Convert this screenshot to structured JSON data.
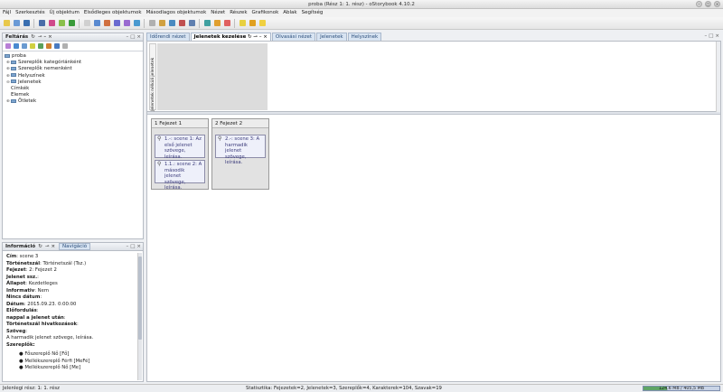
{
  "window": {
    "title": "proba (Rész 1: 1. rész) - oStorybook 4.10.2"
  },
  "menu": [
    "Fájl",
    "Szerkesztés",
    "Új objektum",
    "Elsődleges objektumok",
    "Másodlagos objektumok",
    "Nézet",
    "Részek",
    "Grafikonok",
    "Ablak",
    "Segítség"
  ],
  "toolbar": {
    "colors": [
      "#e8c84a",
      "#6a9ad6",
      "#3a6fb0",
      "#4a6da8",
      "#d04a8a",
      "#8ac04a",
      "#3a9b3a",
      "#d0d0d0",
      "#5a8ad0",
      "#d07040",
      "#6a6ad0",
      "#9a6ad0",
      "#4a9ad0",
      "#b0b0b0",
      "#d0a040",
      "#4a8ac0",
      "#c05050",
      "#6080b0",
      "#40a0a0",
      "#e0a030",
      "#e06060",
      "#e8d040",
      "#e0a020",
      "#f0d040"
    ]
  },
  "explorer": {
    "title": "Feltárás",
    "tools": [
      "#b87fd6",
      "#4a8ad0",
      "#6a9ad0",
      "#d0d040",
      "#5aa05a",
      "#d08030",
      "#4a7ac0",
      "#b0b0b0"
    ],
    "tree": {
      "root": "proba",
      "items": [
        {
          "label": "Szereplők kategóriánként",
          "expand": "⊕",
          "folder": true
        },
        {
          "label": "Szereplők nemenként",
          "expand": "⊕",
          "folder": true
        },
        {
          "label": "Helyszínek",
          "expand": "⊕",
          "folder": true
        },
        {
          "label": "Jelenetek",
          "expand": "⊖",
          "folder": true
        },
        {
          "label": "Címkék",
          "expand": "",
          "folder": false
        },
        {
          "label": "Elemek",
          "expand": "",
          "folder": false
        },
        {
          "label": "Ötletek",
          "expand": "⊕",
          "folder": true
        }
      ]
    }
  },
  "info": {
    "tabs": [
      "Információ",
      "Navigáció"
    ],
    "lines": [
      {
        "key": "Cím",
        "value": "scene 3"
      },
      {
        "key": "Történetszál",
        "value": "Történetszál (Tsz.)"
      },
      {
        "key": "Fejezet",
        "value": "2: Fejezet 2"
      },
      {
        "key": "Jelenet ssz.",
        "value": ""
      },
      {
        "key": "Állapot",
        "value": "Kezdetleges"
      },
      {
        "key": "Informativ",
        "value": "Nem"
      },
      {
        "key": "Nincs dátum",
        "value": ""
      },
      {
        "key": "Dátum",
        "value": "2015.09.23. 0:00:00"
      },
      {
        "key": "Előfordulás",
        "value": ""
      },
      {
        "key": "nappal a jelenet után",
        "value": ""
      },
      {
        "key": "Történetszál hivatkozások",
        "value": ""
      },
      {
        "key": "Szöveg",
        "value": ""
      }
    ],
    "text": "A harmadik jelenet szövege, leírása.",
    "characters_label": "Szereplők:",
    "characters": [
      "Főszereplő Nő [Fő]",
      "Mellékszereplő Férfi [MeFé]",
      "Mellékszereplő Nő [Me]"
    ]
  },
  "tabs": [
    "Időrendi nézet",
    "Jelenetek kezelése",
    "Olvasási nézet",
    "Jelenetek",
    "Helyszínek"
  ],
  "active_tab": "Jelenetek kezelése",
  "unassigned_label": "Jelenetek nélküli jelenetek",
  "chapters": [
    {
      "title": "1 Fejezet 1",
      "scenes": [
        "1.-: scene 1: Az első jelenet szövege, leírása.",
        "1.1.: scene 2: A második jelenet szövege, leírása."
      ]
    },
    {
      "title": "2 Fejezet 2",
      "scenes": [
        "2.-: scene 3: A harmadik jelenet szövege, leírása."
      ]
    }
  ],
  "status": {
    "left": "Jelenlegi rész: 1: 1. rész",
    "stats": "Statisztika: Fejezetek=2,  Jelenetek=3,  Szereplők=4,  Karakterek=104,  Szavak=19",
    "memory": "124,6 MB / 405,5 MB",
    "memory_fraction": 0.307
  }
}
